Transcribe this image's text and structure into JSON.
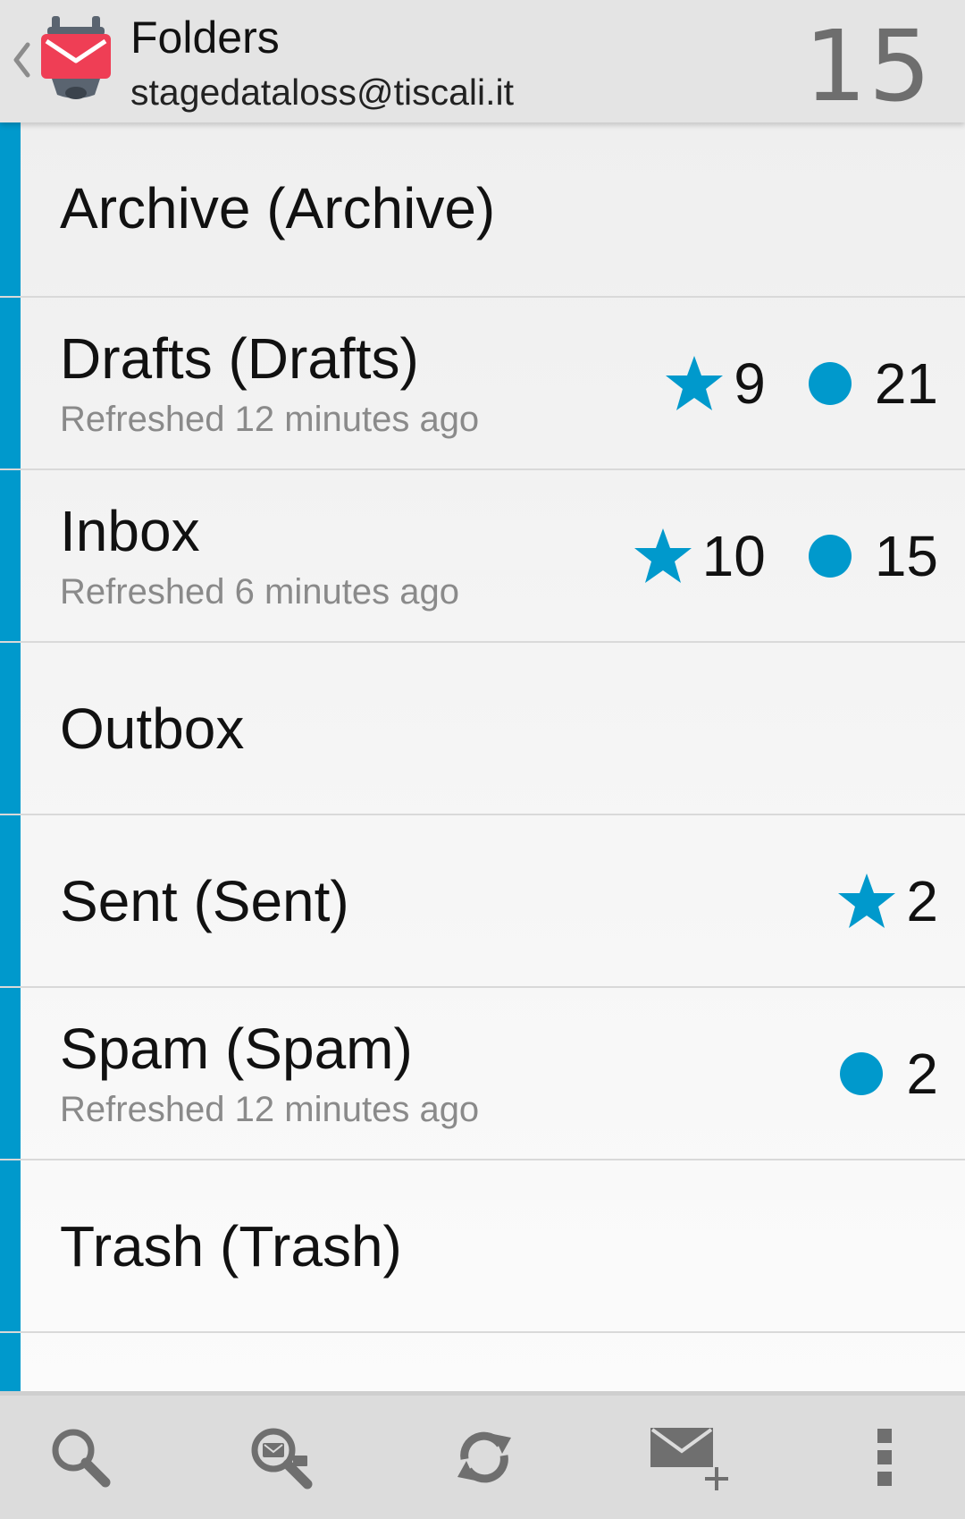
{
  "action_bar": {
    "title": "Folders",
    "account": "stagedataloss@tiscali.it",
    "unread_count": "15",
    "up_icon": "chevron-left-icon",
    "logo_icon": "k9-mail-logo"
  },
  "colors": {
    "accent": "#0099cc",
    "logo_red": "#ef3e55",
    "logo_gray": "#5a6470"
  },
  "folders": [
    {
      "name": "Archive (Archive)",
      "status": "",
      "flagged": "",
      "unread": ""
    },
    {
      "name": "Drafts (Drafts)",
      "status": "Refreshed 12 minutes ago",
      "flagged": "9",
      "unread": "21"
    },
    {
      "name": "Inbox",
      "status": "Refreshed 6 minutes ago",
      "flagged": "10",
      "unread": "15"
    },
    {
      "name": "Outbox",
      "status": "",
      "flagged": "",
      "unread": ""
    },
    {
      "name": "Sent (Sent)",
      "status": "",
      "flagged": "2",
      "unread": ""
    },
    {
      "name": "Spam (Spam)",
      "status": "Refreshed 12 minutes ago",
      "flagged": "",
      "unread": "2"
    },
    {
      "name": "Trash (Trash)",
      "status": "",
      "flagged": "",
      "unread": ""
    }
  ],
  "bottom_bar": {
    "buttons": [
      {
        "icon": "search-icon"
      },
      {
        "icon": "search-remote-icon"
      },
      {
        "icon": "refresh-icon"
      },
      {
        "icon": "compose-icon"
      },
      {
        "icon": "overflow-menu-icon"
      }
    ]
  }
}
